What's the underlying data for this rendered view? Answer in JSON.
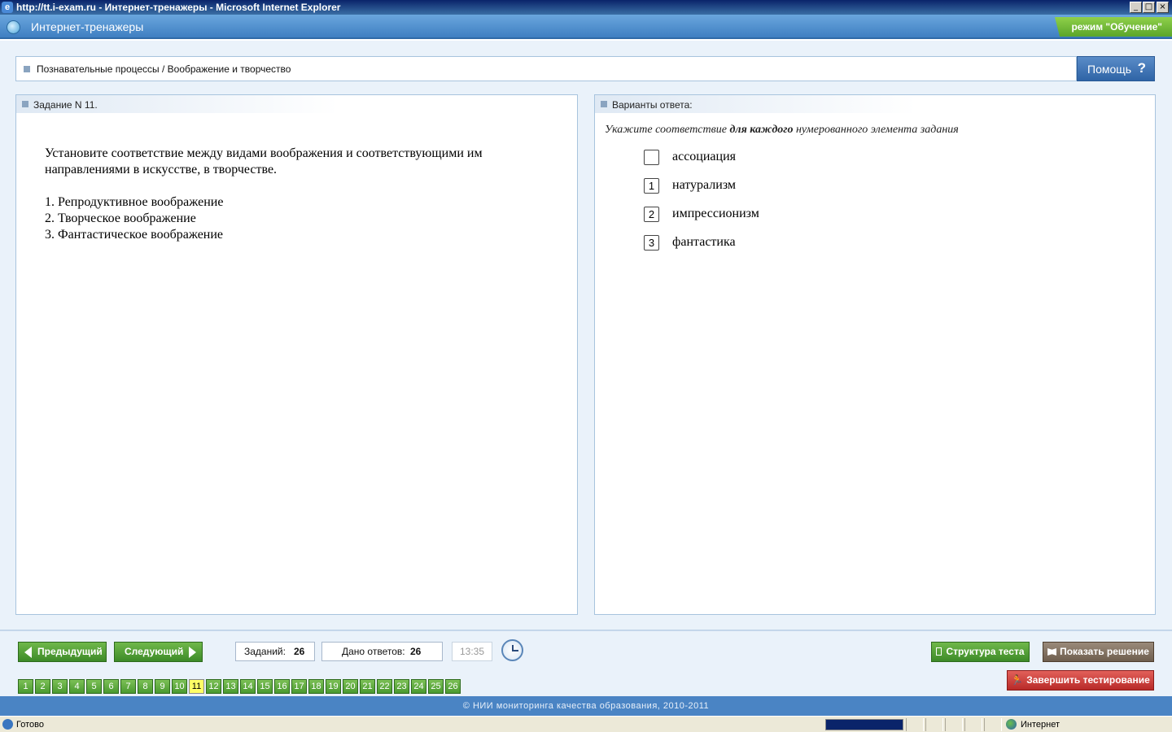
{
  "window": {
    "title": "http://tt.i-exam.ru - Интернет-тренажеры - Microsoft Internet Explorer",
    "min": "_",
    "max": "□",
    "close": "×"
  },
  "app": {
    "title": "Интернет-тренажеры",
    "mode": "режим \"Обучение\""
  },
  "breadcrumb": "Познавательные процессы / Воображение и творчество",
  "help": {
    "label": "Помощь",
    "icon": "?"
  },
  "question": {
    "header": "Задание N 11.",
    "text": "Установите соответствие между видами воображения и соответствующими им направлениями в искусстве, в творчестве.",
    "items": [
      "1. Репродуктивное воображение",
      "2. Творческое воображение",
      "3. Фантастическое воображение"
    ]
  },
  "answers": {
    "header": "Варианты ответа:",
    "instruction_pre": "Укажите соответствие ",
    "instruction_bold": "для каждого",
    "instruction_post": " нумерованного элемента задания",
    "options": [
      {
        "number": "",
        "label": "ассоциация"
      },
      {
        "number": "1",
        "label": "натурализм"
      },
      {
        "number": "2",
        "label": "импрессионизм"
      },
      {
        "number": "3",
        "label": "фантастика"
      }
    ]
  },
  "controls": {
    "prev": "Предыдущий",
    "next": "Следующий",
    "tasks_label": "Заданий:",
    "tasks_value": "26",
    "answered_label": "Дано ответов:",
    "answered_value": "26",
    "timer": "13:35",
    "structure": "Структура теста",
    "show_solution": "Показать решение",
    "finish": "Завершить тестирование"
  },
  "task_numbers": [
    "1",
    "2",
    "3",
    "4",
    "5",
    "6",
    "7",
    "8",
    "9",
    "10",
    "11",
    "12",
    "13",
    "14",
    "15",
    "16",
    "17",
    "18",
    "19",
    "20",
    "21",
    "22",
    "23",
    "24",
    "25",
    "26"
  ],
  "current_task": "11",
  "footer": "© НИИ мониторинга качества образования, 2010-2011",
  "statusbar": {
    "status": "Готово",
    "zone": "Интернет"
  }
}
